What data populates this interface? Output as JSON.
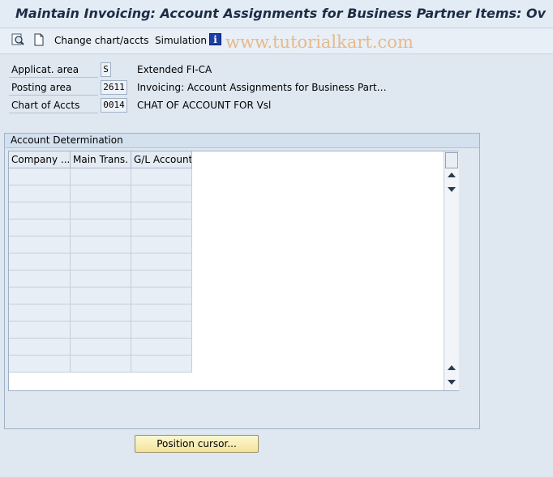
{
  "window": {
    "title": "Maintain Invoicing: Account Assignments for Business Partner Items: Ov"
  },
  "toolbar": {
    "change_chart_label": "Change chart/accts",
    "simulation_label": "Simulation",
    "watermark": "www.tutorialkart.com"
  },
  "fields": [
    {
      "label": "Applicat. area",
      "value": "S",
      "description": "Extended FI-CA"
    },
    {
      "label": "Posting area",
      "value": "2611",
      "description": "Invoicing: Account Assignments for Business Part…"
    },
    {
      "label": "Chart of Accts",
      "value": "0014",
      "description": "CHAT OF ACCOUNT FOR Vsl"
    }
  ],
  "account_determination": {
    "title": "Account Determination",
    "columns": [
      "Company ...",
      "Main Trans.",
      "G/L Account"
    ],
    "rows": [
      [
        "",
        "",
        ""
      ],
      [
        "",
        "",
        ""
      ],
      [
        "",
        "",
        ""
      ],
      [
        "",
        "",
        ""
      ],
      [
        "",
        "",
        ""
      ],
      [
        "",
        "",
        ""
      ],
      [
        "",
        "",
        ""
      ],
      [
        "",
        "",
        ""
      ],
      [
        "",
        "",
        ""
      ],
      [
        "",
        "",
        ""
      ],
      [
        "",
        "",
        ""
      ],
      [
        "",
        "",
        ""
      ]
    ]
  },
  "buttons": {
    "position_cursor": "Position cursor..."
  },
  "colors": {
    "title": "#1b2d45",
    "background": "#dfe7f0",
    "button_fill": "#f3e49c",
    "watermark": "#e8b98a",
    "info_icon": "#1a3fa8"
  }
}
